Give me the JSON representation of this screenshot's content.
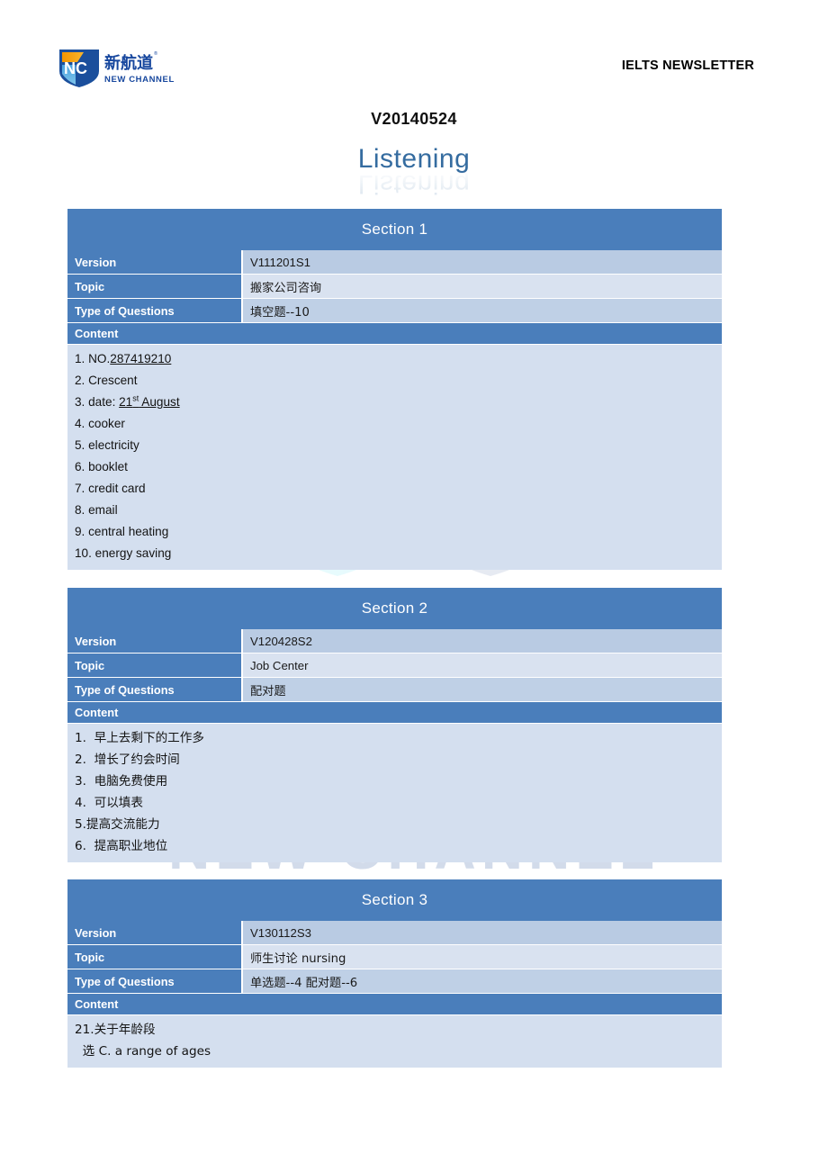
{
  "header": {
    "logo_alt": "new-channel-logo",
    "logo_cn": "新航道",
    "logo_en": "NEW CHANNEL",
    "logo_mark": "NC",
    "newsletter_title": "IELTS NEWSLETTER"
  },
  "title": {
    "version": "V20140524",
    "subtitle": "Listening"
  },
  "watermark": {
    "text": "NEW CHANNEL"
  },
  "table_labels": {
    "version": "Version",
    "topic": "Topic",
    "type_of_questions": "Type of Questions",
    "content": "Content"
  },
  "colors": {
    "header_blue": "#4a7ebb",
    "row_tint_a": "#b9cbe3",
    "row_tint_b": "#d9e2f0",
    "row_tint_c": "#bfd0e6",
    "content_bg": "#d4dfef",
    "subtitle_blue": "#356ca0"
  },
  "sections": [
    {
      "heading": "Section 1",
      "version": "V111201S1",
      "topic": "搬家公司咨询",
      "type_of_questions": "填空题--10",
      "content": [
        {
          "prefix": "1. NO.",
          "underline": "287419210",
          "suffix": ""
        },
        {
          "prefix": "2. Crescent",
          "underline": "",
          "suffix": ""
        },
        {
          "prefix": "3. date: ",
          "underline": "21st August",
          "underline_sup": "st",
          "suffix": ""
        },
        {
          "prefix": "4. cooker",
          "underline": "",
          "suffix": ""
        },
        {
          "prefix": "5. electricity",
          "underline": "",
          "suffix": ""
        },
        {
          "prefix": "6. booklet",
          "underline": "",
          "suffix": ""
        },
        {
          "prefix": "7. credit card",
          "underline": "",
          "suffix": ""
        },
        {
          "prefix": "8. email",
          "underline": "",
          "suffix": ""
        },
        {
          "prefix": "9. central heating",
          "underline": "",
          "suffix": ""
        },
        {
          "prefix": "10. energy saving",
          "underline": "",
          "suffix": ""
        }
      ]
    },
    {
      "heading": "Section 2",
      "version": "V120428S2",
      "topic": "Job Center",
      "type_of_questions": "配对题",
      "content": [
        {
          "prefix": "1.  早上去剩下的工作多",
          "underline": "",
          "suffix": ""
        },
        {
          "prefix": "2.  增长了约会时间",
          "underline": "",
          "suffix": ""
        },
        {
          "prefix": "3.  电脑免费使用",
          "underline": "",
          "suffix": ""
        },
        {
          "prefix": "4.  可以填表",
          "underline": "",
          "suffix": ""
        },
        {
          "prefix": "5.提高交流能力",
          "underline": "",
          "suffix": ""
        },
        {
          "prefix": "6.  提高职业地位",
          "underline": "",
          "suffix": ""
        }
      ]
    },
    {
      "heading": "Section 3",
      "version": "V130112S3",
      "topic": "师生讨论 nursing",
      "type_of_questions": "单选题--4    配对题--6",
      "content": [
        {
          "prefix": "21.关于年龄段",
          "underline": "",
          "suffix": ""
        },
        {
          "prefix": "  选 C. a range of ages",
          "underline": "",
          "suffix": ""
        }
      ]
    }
  ]
}
